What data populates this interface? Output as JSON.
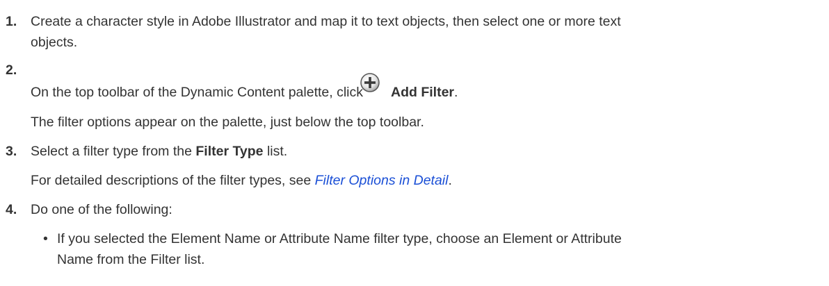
{
  "steps": [
    {
      "number": "1.",
      "text_line1": "Create a character style in Adobe Illustrator and map it to text objects, then select one or more text",
      "text_line2": "objects."
    },
    {
      "number": "2.",
      "text_before_icon": "On the top toolbar of the Dynamic Content palette, click",
      "icon": "add-filter-plus-icon",
      "bold_label": "Add Filter",
      "text_after_bold": ".",
      "note": "The filter options appear on the palette, just below the top toolbar."
    },
    {
      "number": "3.",
      "text_before_bold": "Select a filter type from the",
      "bold_label": "Filter Type",
      "text_after_bold": "list.",
      "note_before_link": "For detailed descriptions of the filter types, see",
      "link_text": "Filter Options in Detail",
      "note_after_link": "."
    },
    {
      "number": "4.",
      "text": "Do one of the following:",
      "bullets": [
        {
          "line1": "If you selected the Element Name or Attribute Name filter type, choose an Element or Attribute",
          "line2": "Name from the Filter list."
        }
      ]
    }
  ],
  "colors": {
    "text": "#333333",
    "link": "#1a4fd6"
  }
}
